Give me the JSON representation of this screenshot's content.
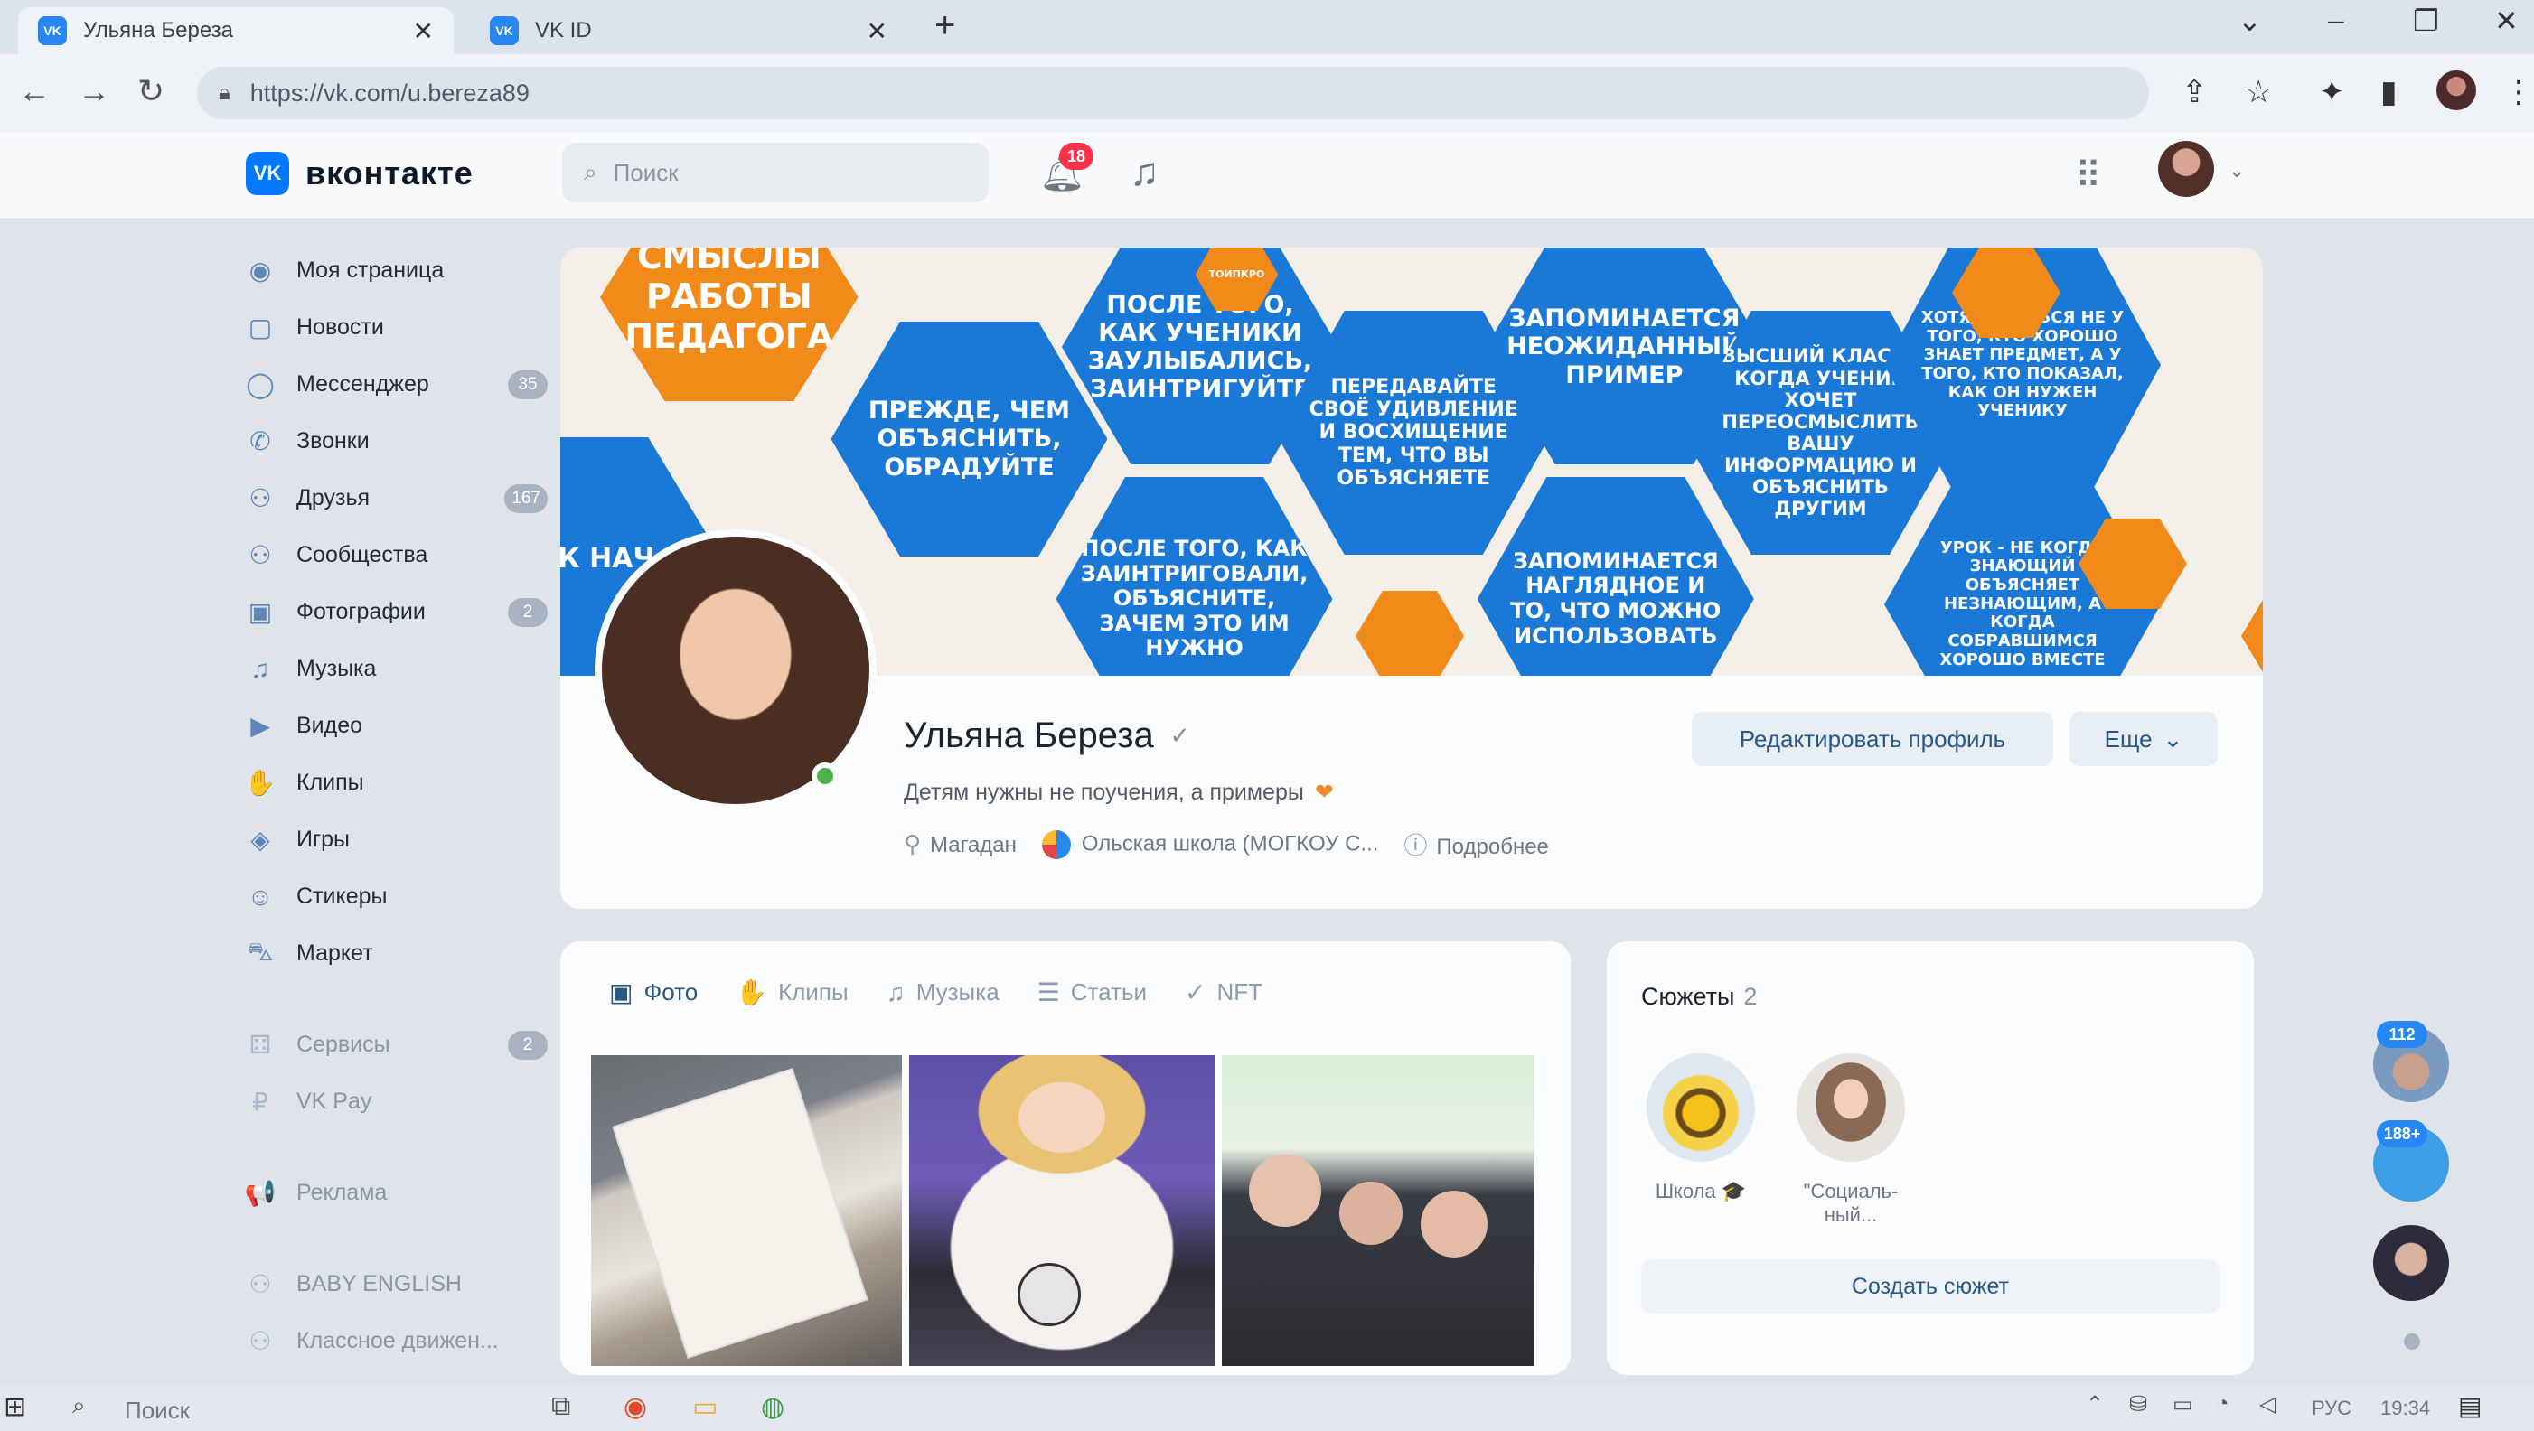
{
  "browser": {
    "tabs": [
      {
        "title": "Ульяна Береза",
        "favicon": "VK"
      },
      {
        "title": "VK ID",
        "favicon": "VK"
      }
    ],
    "new_tab": "+",
    "window_controls": {
      "chevron": "⌄",
      "minimize": "–",
      "restore": "❐",
      "close": "✕"
    },
    "url": "https://vk.com/u.bereza89"
  },
  "header": {
    "logo_mark": "VK",
    "logo_text": "вконтакте",
    "search_placeholder": "Поиск",
    "notifications_count": "18"
  },
  "sidebar": {
    "items": [
      {
        "label": "Моя страница",
        "icon": "user-circle-icon",
        "glyph": "◉",
        "count": ""
      },
      {
        "label": "Новости",
        "icon": "news-icon",
        "glyph": "▢",
        "count": ""
      },
      {
        "label": "Мессенджер",
        "icon": "message-icon",
        "glyph": "◯",
        "count": "35"
      },
      {
        "label": "Звонки",
        "icon": "phone-icon",
        "glyph": "✆",
        "count": ""
      },
      {
        "label": "Друзья",
        "icon": "friends-icon",
        "glyph": "⚇",
        "count": "167"
      },
      {
        "label": "Сообщества",
        "icon": "communities-icon",
        "glyph": "⚇",
        "count": ""
      },
      {
        "label": "Фотографии",
        "icon": "photo-icon",
        "glyph": "▣",
        "count": "2"
      },
      {
        "label": "Музыка",
        "icon": "music-icon",
        "glyph": "♫",
        "count": ""
      },
      {
        "label": "Видео",
        "icon": "video-icon",
        "glyph": "▶",
        "count": ""
      },
      {
        "label": "Клипы",
        "icon": "clips-icon",
        "glyph": "✋",
        "count": ""
      },
      {
        "label": "Игры",
        "icon": "games-icon",
        "glyph": "◈",
        "count": ""
      },
      {
        "label": "Стикеры",
        "icon": "stickers-icon",
        "glyph": "☺",
        "count": ""
      },
      {
        "label": "Маркет",
        "icon": "market-icon",
        "glyph": "⛍",
        "count": ""
      }
    ],
    "items2": [
      {
        "label": "Сервисы",
        "icon": "services-icon",
        "glyph": "⚃",
        "count": "2"
      },
      {
        "label": "VK Pay",
        "icon": "vkpay-icon",
        "glyph": "₽",
        "count": ""
      }
    ],
    "items3": [
      {
        "label": "Реклама",
        "icon": "ads-icon",
        "glyph": "📢",
        "count": ""
      }
    ],
    "items4": [
      {
        "label": "BABY ENGLISH",
        "icon": "community-icon",
        "glyph": "⚇",
        "count": ""
      },
      {
        "label": "Классное движен...",
        "icon": "community-icon",
        "glyph": "⚇",
        "count": ""
      }
    ]
  },
  "cover": {
    "hexes": [
      "СМЫСЛЫ РАБОТЫ ПЕДАГОГА",
      "ПОСЛЕ ТОГО, КАК УЧЕНИКИ ЗАУЛЫБАЛИСЬ, ЗАИНТРИГУЙТЕ",
      "ПРЕЖДЕ, ЧЕМ ОБЪЯСНИТЬ, ОБРАДУЙТЕ",
      "ПЕРЕДАВАЙТЕ СВОЁ УДИВЛЕНИЕ И ВОСХИЩЕНИЕ ТЕМ, ЧТО ВЫ ОБЪЯСНЯЕТЕ",
      "ЗАПОМИНАЕТСЯ НЕОЖИДАННЫЙ ПРИМЕР",
      "ВЫСШИЙ КЛАСС - КОГДА УЧЕНИК ХОЧЕТ ПЕРЕОСМЫСЛИТЬ ВАШУ ИНФОРМАЦИЮ И ОБЪЯСНИТЬ ДРУГИМ",
      "ХОТЯТ УЧИТЬСЯ НЕ У ТОГО, КТО ХОРОШО ЗНАЕТ ПРЕДМЕТ, А У ТОГО, КТО ПОКАЗАЛ, КАК ОН НУЖЕН УЧЕНИКУ",
      "УРОК НАЧ",
      "ПОСЛЕ ТОГО, КАК ЗАИНТРИГОВАЛИ, ОБЪЯСНИТЕ, ЗАЧЕМ ЭТО ИМ НУЖНО",
      "ЗАПОМИНАЕТСЯ НАГЛЯДНОЕ И ТО, ЧТО МОЖНО ИСПОЛЬЗОВАТЬ",
      "УРОК - НЕ КОГДА ЗНАЮЩИЙ ОБЪЯСНЯЕТ НЕЗНАЮЩИМ, А КОГДА СОБРАВШИМСЯ ХОРОШО ВМЕСТЕ",
      "ТОИПКРО",
      "ТОИПКРО"
    ]
  },
  "profile": {
    "name": "Ульяна Береза",
    "status": "Детям нужны не поучения, а примеры",
    "city": "Магадан",
    "school": "Ольская школа (МОГКОУ С...",
    "more_info": "Подробнее",
    "edit_button": "Редактировать профиль",
    "more_button": "Еще",
    "online": true
  },
  "media_tabs": [
    {
      "label": "Фото",
      "icon": "photo-icon",
      "glyph": "▣"
    },
    {
      "label": "Клипы",
      "icon": "clips-icon",
      "glyph": "✋"
    },
    {
      "label": "Музыка",
      "icon": "music-icon",
      "glyph": "♫"
    },
    {
      "label": "Статьи",
      "icon": "articles-icon",
      "glyph": "☰"
    },
    {
      "label": "NFT",
      "icon": "nft-icon",
      "glyph": "✓"
    }
  ],
  "stories": {
    "title": "Сюжеты",
    "count": "2",
    "items": [
      {
        "label": "Школа 🎓"
      },
      {
        "label": "\"Социаль-ный..."
      }
    ],
    "create_button": "Создать сюжет"
  },
  "chats": [
    {
      "badge": "112"
    },
    {
      "badge": "188+"
    },
    {
      "badge": ""
    }
  ],
  "taskbar": {
    "search": "Поиск",
    "lang": "РУС",
    "time": "19:34"
  }
}
